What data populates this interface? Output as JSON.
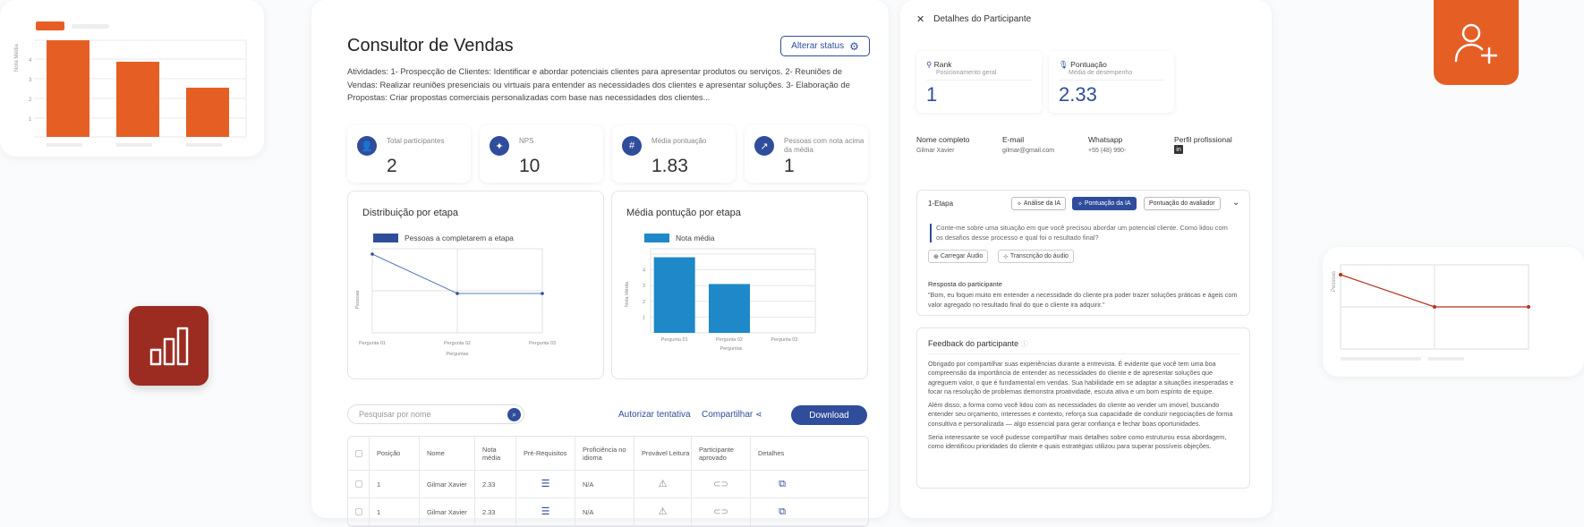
{
  "page": {
    "title": "Consultor de Vendas",
    "status_button": "Alterar status",
    "description": "Atividades: 1- Prospecção de Clientes: Identificar e abordar potenciais clientes para apresentar produtos ou serviços. 2- Reuniões de Vendas: Realizar reuniões presenciais ou virtuais para entender as necessidades dos clientes e apresentar soluções. 3- Elaboração de Propostas: Criar propostas comerciais personalizadas com base nas necessidades dos clientes..."
  },
  "stats": [
    {
      "label": "Total participantes",
      "value": "2",
      "icon": "users-icon"
    },
    {
      "label": "NPS",
      "value": "10",
      "icon": "sparkle-icon"
    },
    {
      "label": "Média pontuação",
      "value": "1.83",
      "icon": "hash-icon"
    },
    {
      "label": "Pessoas com nota acima da média",
      "value": "1",
      "icon": "trend-up-icon"
    }
  ],
  "chart_data": [
    {
      "type": "line",
      "title": "Distribuição por etapa",
      "legend": "Pessoas a completarem a etapa",
      "xlabel": "Perguntas",
      "ylabel": "Pessoas",
      "categories": [
        "Pergunta 01",
        "Pergunta 02",
        "Pergunta 03"
      ],
      "values": [
        2,
        1,
        1
      ],
      "ylim": [
        0,
        2
      ]
    },
    {
      "type": "bar",
      "title": "Média pontução por etapa",
      "legend": "Nota média",
      "xlabel": "Perguntas",
      "ylabel": "Nota Média",
      "categories": [
        "Pergunta 01",
        "Pergunta 02",
        "Pergunta 03"
      ],
      "values": [
        4.8,
        3.1,
        0
      ],
      "ylim": [
        0,
        5
      ]
    }
  ],
  "deco_bar_chart": {
    "ylabel": "Nota Média",
    "ticks": [
      "1",
      "2",
      "3",
      "4"
    ],
    "values": [
      4.8,
      3.8,
      2.5
    ]
  },
  "deco_line_chart": {
    "ylabel": "Pessoas"
  },
  "toolbar": {
    "search_placeholder": "Pesquisar por nome",
    "authorize": "Autorizar tentativa",
    "share": "Compartilhar",
    "download": "Download"
  },
  "table": {
    "headers": [
      "Posição",
      "Nome",
      "Nota média",
      "Pré-Requisitos",
      "Proficiência no idioma",
      "Provável Leitura",
      "Participante aprovado",
      "Detalhes"
    ],
    "rows": [
      {
        "position": "1",
        "name": "Gilmar Xavier",
        "score": "2.33",
        "proficiency": "N/A"
      },
      {
        "position": "1",
        "name": "Gilmar Xavier",
        "score": "2.33",
        "proficiency": "N/A"
      }
    ]
  },
  "details": {
    "header": "Detalhes do Participante",
    "rank": {
      "title": "Rank",
      "sub": "Posicionamento geral",
      "value": "1"
    },
    "score": {
      "title": "Pontuação",
      "sub": "Média de desempenho",
      "value": "2.33"
    },
    "info": [
      {
        "label": "Nome completo",
        "value": "Gilmar Xavier"
      },
      {
        "label": "E-mail",
        "value": "gilmar@gmail.com"
      },
      {
        "label": "Whatsapp",
        "value": "+55 (48) 990-"
      },
      {
        "label": "Perfil profissional",
        "value": ""
      }
    ],
    "stage": {
      "title": "1-Etapa",
      "tabs": [
        "Análise da IA",
        "Pontuação da IA",
        "Pontuação do avaliador"
      ],
      "question": "Conte-me sobre uma situação em que você precisou abordar um potencial cliente. Como lidou com os desafios desse processo e qual foi o resultado final?",
      "upload_audio": "Carregar Áudio",
      "transcription": "Transcrição do áudio",
      "answer_title": "Resposta do participante",
      "answer": "\"Bom, eu foquei muito em entender a necessidade do cliente pra poder trazer soluções práticas e ágeis com valor agregado no resultado final do que o cliente ira adquirir.\""
    },
    "feedback": {
      "title": "Feedback do participante",
      "p1": "Obrigado por compartilhar suas experiências durante a entrevista. É evidente que você tem uma boa compreensão da importância de entender as necessidades do cliente e de apresentar soluções que agreguem valor, o que é fundamental em vendas. Sua habilidade em se adaptar a situações inesperadas e focar na resolução de problemas demonstra proatividade, escuta ativa e um bom espírito de equipe.",
      "p2": "Além disso, a forma como você lidou com as necessidades do cliente ao vender um imóvel, buscando entender seu orçamento, interesses e contexto, reforça sua capacidade de conduzir negociações de forma consultiva e personalizada — algo essencial para gerar confiança e fechar boas oportunidades.",
      "p3": "Seria interessante se você pudesse compartilhar mais detalhes sobre como estruturou essa abordagem, como identificou prioridades do cliente e quais estratégias utilizou para superar possíveis objeções."
    }
  },
  "colors": {
    "primary": "#2f4d9b",
    "orange": "#e55f25",
    "dark_red": "#9c2c21",
    "bar_blue": "#1e88c8"
  }
}
